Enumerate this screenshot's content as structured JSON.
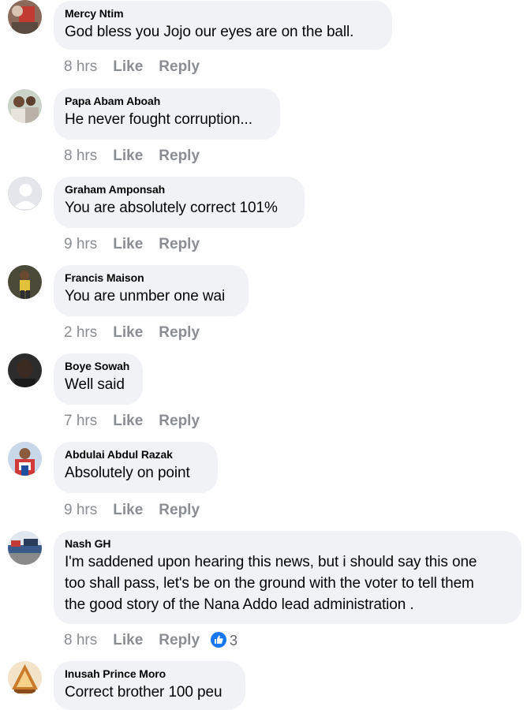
{
  "comments": [
    {
      "author": "Mercy Ntim",
      "text": "God bless  you Jojo  our eyes are on the ball.",
      "time": "8 hrs"
    },
    {
      "author": "Papa Abam Aboah",
      "text": "He never fought corruption...",
      "time": "8 hrs"
    },
    {
      "author": "Graham Amponsah",
      "text": "You are absolutely correct 101%",
      "time": "9 hrs"
    },
    {
      "author": "Francis Maison",
      "text": "You are unmber one wai",
      "time": "2 hrs"
    },
    {
      "author": "Boye Sowah",
      "text": "Well said",
      "time": "7 hrs"
    },
    {
      "author": "Abdulai Abdul Razak",
      "text": "Absolutely on point",
      "time": "9 hrs"
    },
    {
      "author": "Nash GH",
      "text_lines": [
        "I'm saddened upon hearing this news, but i should say this one",
        "too shall pass, let's be on the ground with the voter to tell them",
        "the good story of the Nana Addo lead administration ."
      ],
      "time": "8 hrs",
      "reaction_count": "3"
    },
    {
      "author": "Inusah Prince Moro",
      "text": "Correct brother 100 peu",
      "time": ""
    }
  ],
  "labels": {
    "like": "Like",
    "reply": "Reply"
  },
  "colors": {
    "bubble": "#f0f2f5",
    "meta": "#8a8d91",
    "like_blue": "#1877f2"
  },
  "icons": {
    "reaction": "like-reaction-icon",
    "default_avatar": "default-avatar-icon"
  }
}
